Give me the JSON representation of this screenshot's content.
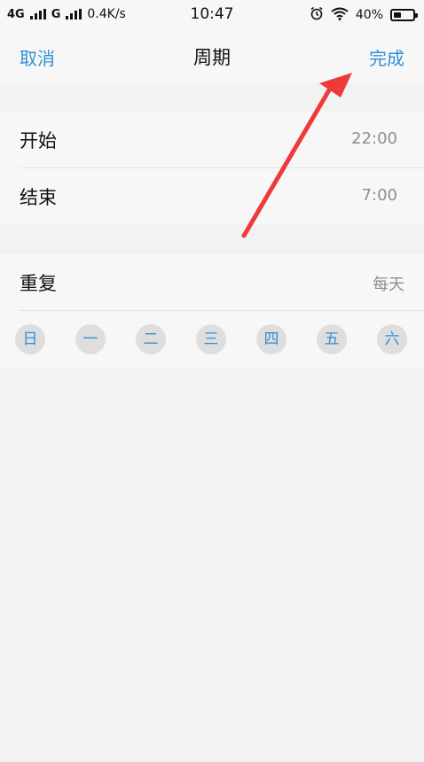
{
  "status_bar": {
    "network1": "4G",
    "network2": "G",
    "speed": "0.4K/s",
    "time": "10:47",
    "battery_percent": "40%",
    "battery_level": 0.4,
    "icons": [
      "signal-icon",
      "alarm-icon",
      "wifi-icon",
      "battery-icon"
    ]
  },
  "nav": {
    "cancel": "取消",
    "title": "周期",
    "done": "完成"
  },
  "time_section": {
    "start_label": "开始",
    "start_value": "22:00",
    "end_label": "结束",
    "end_value": "7:00"
  },
  "repeat_section": {
    "label": "重复",
    "value": "每天",
    "days": [
      "日",
      "一",
      "二",
      "三",
      "四",
      "五",
      "六"
    ]
  },
  "colors": {
    "accent": "#2f8fd6",
    "annotation": "#f03a3a"
  }
}
